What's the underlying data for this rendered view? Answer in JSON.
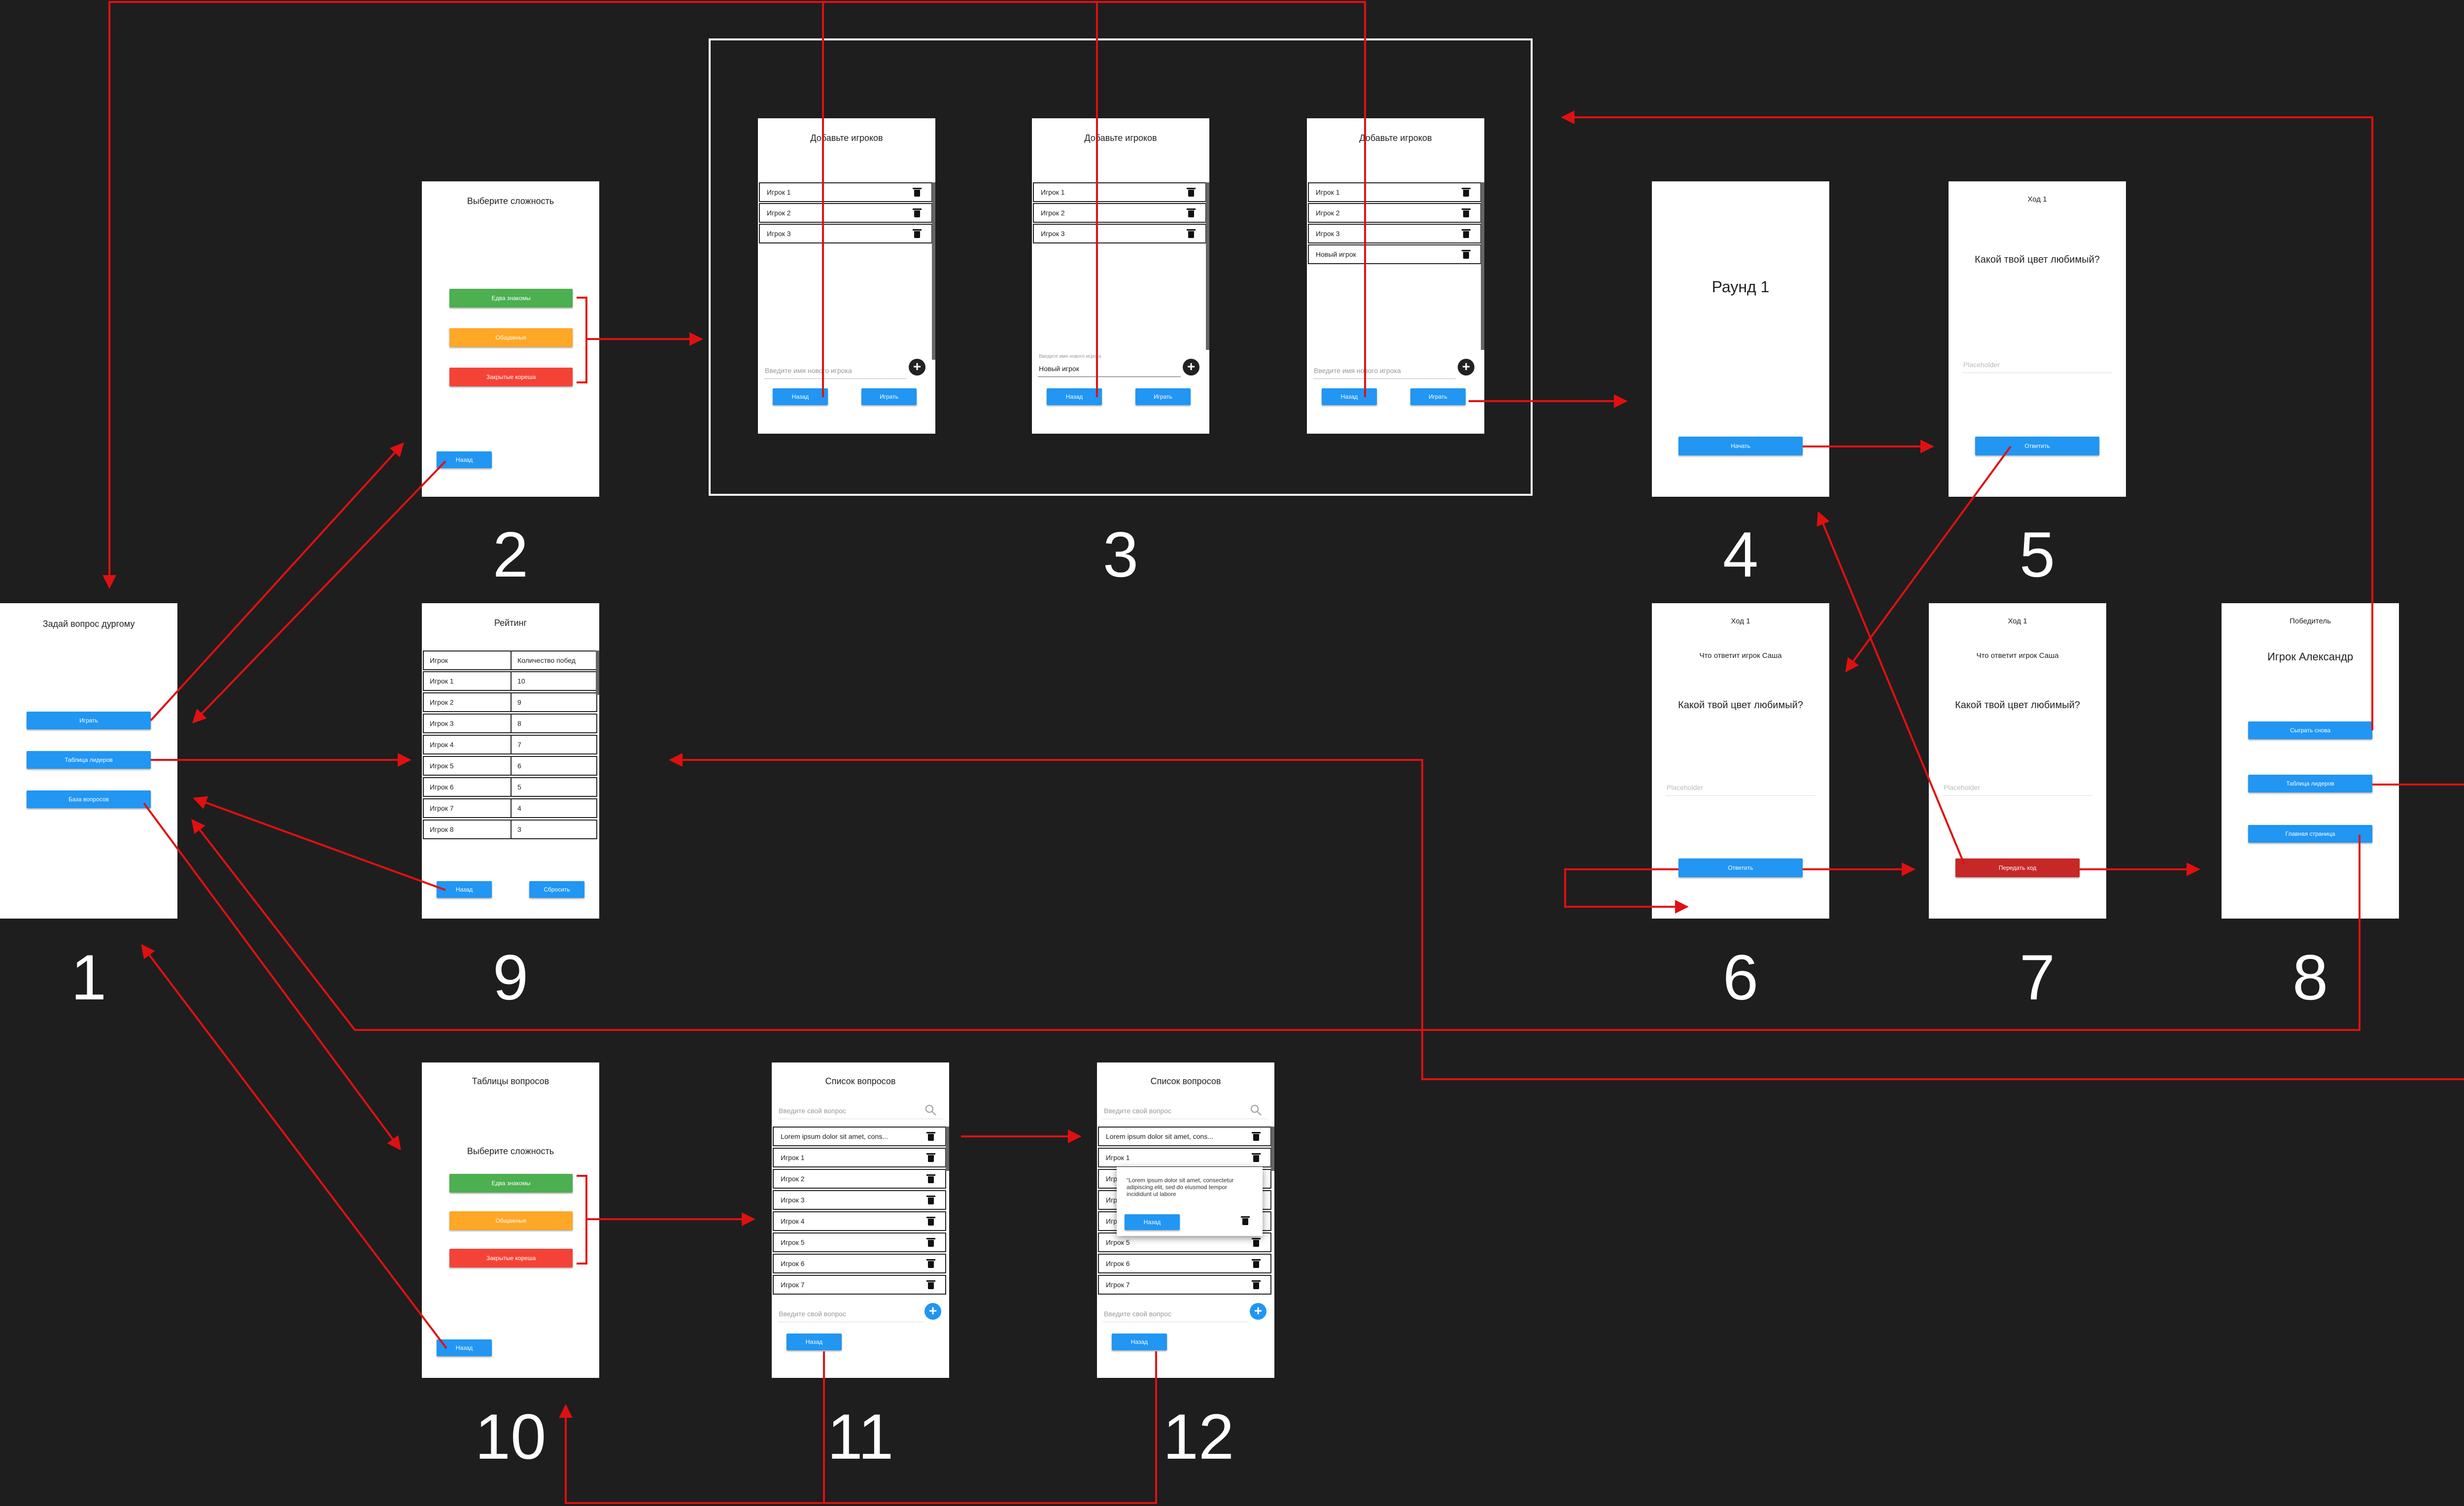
{
  "labels": [
    "1",
    "2",
    "3",
    "4",
    "5",
    "6",
    "7",
    "8",
    "9",
    "10",
    "11",
    "12"
  ],
  "screen1": {
    "title": "Задай вопрос дургому",
    "btn_play": "Играть",
    "btn_leaders": "Таблица лидеров",
    "btn_questions": "База вопросов"
  },
  "screen2": {
    "title": "Выберите сложность",
    "easy": "Едва знакомы",
    "mid": "Общажные",
    "hard": "Закрытые кореша",
    "back": "Назад"
  },
  "screen3": {
    "title": "Добавьте игроков",
    "players": [
      "Игрок 1",
      "Игрок 2",
      "Игрок 3"
    ],
    "new_player": "Новый игрок",
    "placeholder": "Введите имя нового игрока",
    "float_label": "Введите имя нового игрока",
    "input_value": "Новый игрок",
    "back": "Назад",
    "play": "Играть"
  },
  "screen4": {
    "title": "Раунд 1",
    "start": "Начать"
  },
  "screen5": {
    "turn": "Ход 1",
    "question": "Какой твой цвет любимый?",
    "placeholder": "Placeholder",
    "answer": "Ответить"
  },
  "screen6": {
    "turn": "Ход 1",
    "prompt": "Что ответит игрок Саша",
    "question": "Какой твой цвет любимый?",
    "placeholder": "Placeholder",
    "answer": "Ответить"
  },
  "screen7": {
    "turn": "Ход 1",
    "prompt": "Что ответит игрок Саша",
    "question": "Какой твой цвет любимый?",
    "placeholder": "Placeholder",
    "pass": "Передать ход"
  },
  "screen8": {
    "title": "Победитель",
    "winner": "Игрок Александр",
    "again": "Сыграть снова",
    "leaders": "Таблица лидеров",
    "home": "Главная страница"
  },
  "screen9": {
    "title": "Рейтинг",
    "col_player": "Игрок",
    "col_wins": "Количество побед",
    "rows": [
      {
        "p": "Игрок 1",
        "w": "10"
      },
      {
        "p": "Игрок 2",
        "w": "9"
      },
      {
        "p": "Игрок 3",
        "w": "8"
      },
      {
        "p": "Игрок 4",
        "w": "7"
      },
      {
        "p": "Игрок 5",
        "w": "6"
      },
      {
        "p": "Игрок 6",
        "w": "5"
      },
      {
        "p": "Игрок 7",
        "w": "4"
      },
      {
        "p": "Игрок 8",
        "w": "3"
      }
    ],
    "back": "Назад",
    "reset": "Сбросить"
  },
  "screen10": {
    "title": "Таблицы вопросов",
    "subtitle": "Выберите сложность",
    "easy": "Едва знакомы",
    "mid": "Общажные",
    "hard": "Закрытые кореша",
    "back": "Назад"
  },
  "screen11": {
    "title": "Список вопросов",
    "search": "Введите свой вопрос",
    "items": [
      "Lorem ipsum dolor sit amet, cons...",
      "Игрок 1",
      "Игрок 2",
      "Игрок 3",
      "Игрок 4",
      "Игрок 5",
      "Игрок 6",
      "Игрок 7"
    ],
    "add": "Введите свой вопрос",
    "back": "Назад"
  },
  "screen12": {
    "title": "Список вопросов",
    "search": "Введите свой вопрос",
    "items": [
      "Lorem ipsum dolor sit amet, cons...",
      "Игрок 1",
      "Игрок 2",
      "Игрок 3",
      "Игрок 4",
      "Игрок 5",
      "Игрок 6",
      "Игрок 7"
    ],
    "popup_text": "“Lorem ipsum dolor sit amet, consectetur adipiscing elit, sed do eiusmod tempor incididunt ut labore",
    "popup_back": "Назад",
    "add": "Введите свой вопрос",
    "back": "Назад"
  },
  "colors": {
    "canvas": "#1e1e1e",
    "arrow": "#e01010",
    "primary": "#2196f3",
    "easy": "#4caf50",
    "mid": "#ffa726",
    "hard": "#f44336",
    "pass": "#c62828"
  }
}
